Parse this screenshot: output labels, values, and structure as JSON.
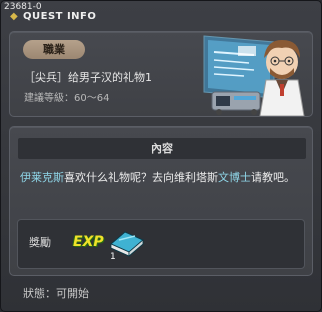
{
  "window": {
    "quest_id": "23681-0",
    "title": "QUEST INFO"
  },
  "quest": {
    "job_badge": "職業",
    "name": "［尖兵］给男子汉的礼物1",
    "level_range": "建議等級：60～64"
  },
  "content": {
    "header": "內容",
    "desc_name1": "伊莱克斯",
    "desc_mid": "喜欢什么礼物呢？去向维利塔斯",
    "desc_name2": "文博士",
    "desc_end": "请教吧。"
  },
  "reward": {
    "label": "獎勵",
    "exp_label": "EXP",
    "item_quantity": "1"
  },
  "status": {
    "text": "狀態：可開始"
  },
  "colors": {
    "highlight": "#8fd6e8",
    "badge": "#b5a18b",
    "exp": "#f0e22a"
  }
}
